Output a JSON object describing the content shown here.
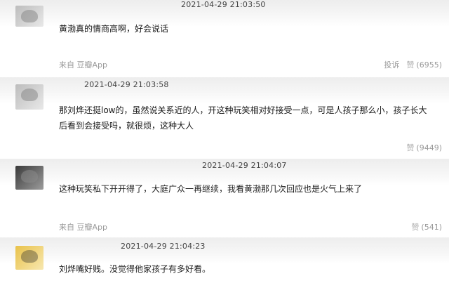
{
  "comments": [
    {
      "timestamp": "2021-04-29 21:03:50",
      "text": "黄渤真的情商高啊，好会说话",
      "source": "来自 豆瓣App",
      "report_label": "投诉",
      "like_label": "赞",
      "like_count": "(6955)"
    },
    {
      "timestamp": "2021-04-29 21:03:58",
      "text": "那刘烨还挺low的，虽然说关系近的人，开这种玩笑相对好接受一点，可是人孩子那么小，孩子长大后看到会接受吗，就很烦，这种大人",
      "like_label": "赞",
      "like_count": "(9449)"
    },
    {
      "timestamp": "2021-04-29 21:04:07",
      "text": "这种玩笑私下开开得了，大庭广众一再继续，我看黄渤那几次回应也是火气上来了",
      "source": "来自 豆瓣App",
      "like_label": "赞",
      "like_count": "(541)"
    },
    {
      "timestamp": "2021-04-29 21:04:23",
      "text": "刘烨嘴好贱。没觉得他家孩子有多好看。"
    }
  ]
}
